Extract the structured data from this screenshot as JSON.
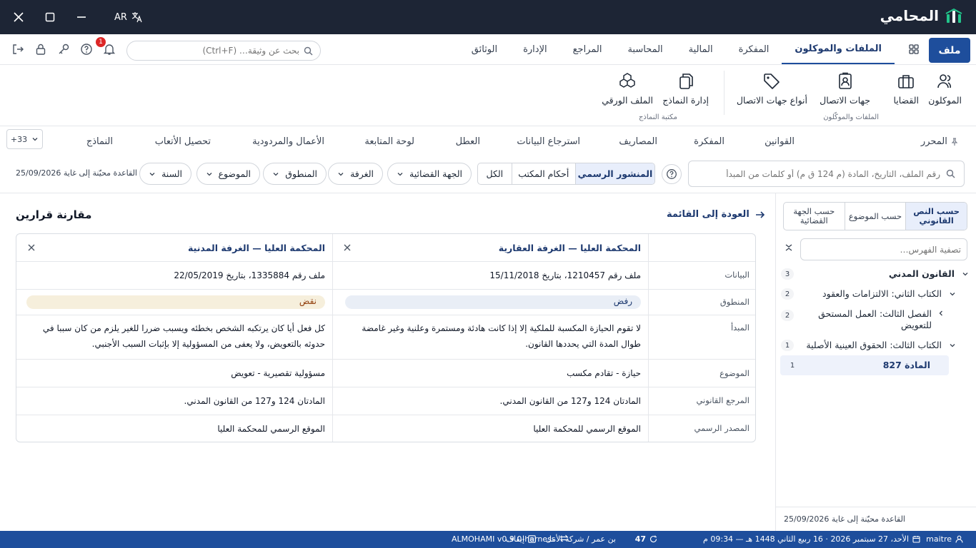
{
  "app": {
    "name": "المحامي",
    "lang": "AR"
  },
  "menu": {
    "file": "ملف",
    "tabs": [
      "الملفات والموكلون",
      "المفكرة",
      "المالية",
      "المحاسبة",
      "المراجع",
      "الإدارة",
      "الوثائق"
    ],
    "search_placeholder": "بحث عن وثيقة… (Ctrl+F)",
    "notifications_count": "1"
  },
  "ribbon": {
    "group1_items": [
      "الموكلون",
      "القضايا",
      "جهات الاتصال",
      "أنواع جهات الاتصال"
    ],
    "group1_label": "الملفات والموكّلون",
    "group2_items": [
      "إدارة النماذج",
      "الملف الورقي"
    ],
    "group2_label": "مكتبة النماذج"
  },
  "tabs2": {
    "items": [
      "المحرر",
      "القوانين",
      "المفكرة",
      "المصاريف",
      "استرجاع البيانات",
      "العطل",
      "لوحة المتابعة",
      "الأعمال والمردودية",
      "تحصيل الأتعاب",
      "النماذج"
    ],
    "more": "+33"
  },
  "filters": {
    "search_placeholder": "رقم الملف، التاريخ، المادة (م 124 ق م) أو كلمات من المبدأ",
    "segments": [
      "المنشور الرسمي",
      "أحكام المكتب",
      "الكل"
    ],
    "dropdowns": [
      "الجهة القضائية",
      "الغرفة",
      "المنطوق",
      "الموضوع",
      "السنة"
    ],
    "db_date": "القاعدة محيّنة إلى غاية 25/09/2026"
  },
  "sidebar": {
    "tabs": [
      "حسب النص القانوني",
      "حسب الموضوع",
      "حسب الجهة القضائية"
    ],
    "filter_placeholder": "تصفية الفهرس…",
    "tree": [
      {
        "label": "القانون المدني",
        "count": "3"
      },
      {
        "label": "الكتاب الثاني: الالتزامات والعقود",
        "count": "2"
      },
      {
        "label1": "الفصل الثالث: العمل المستحق",
        "label2": "للتعويض",
        "count": "2"
      },
      {
        "label": "الكتاب الثالث: الحقوق العينية الأصلية",
        "count": "1"
      },
      {
        "label": "المادة 827",
        "count": "1"
      }
    ],
    "footer": "القاعدة محيّنة إلى غاية 25/09/2026"
  },
  "compare": {
    "back": "العودة إلى القائمة",
    "title": "مقارنة قرارين",
    "col1_title": "المحكمة العليا — الغرفة العقارية",
    "col2_title": "المحكمة العليا — الغرفة المدنية",
    "rows": {
      "data_label": "البيانات",
      "data_1": "ملف رقم 1210457، بتاريخ 15/11/2018",
      "data_2": "ملف رقم 1335884، بتاريخ 22/05/2019",
      "ruling_label": "المنطوق",
      "ruling_1": "رفض",
      "ruling_2": "نقض",
      "principle_label": "المبدأ",
      "principle_1": "لا تقوم الحيازة المكسبة للملكية إلا إذا كانت هادئة ومستمرة وعلنية وغير غامضة طوال المدة التي يحددها القانون.",
      "principle_2": "كل فعل أيا كان يرتكبه الشخص بخطئه ويسبب ضررا للغير يلزم من كان سببا في حدوثه بالتعويض، ولا يعفى من المسؤولية إلا بإثبات السبب الأجنبي.",
      "subject_label": "الموضوع",
      "subject_1": "حيازة - تقادم مكسب",
      "subject_2": "مسؤولية تقصيرية - تعويض",
      "ref_label": "المرجع القانوني",
      "ref_1": "المادتان 124 و127 من القانون المدني.",
      "ref_2": "المادتان 124 و127 من القانون المدني.",
      "source_label": "المصدر الرسمي",
      "source_1": "الموقع الرسمي للمحكمة العليا",
      "source_2": "الموقع الرسمي للمحكمة العليا"
    }
  },
  "status": {
    "user": "maitre",
    "date": "الأحد، 27 سبتمبر 2026 · 16 ربيع الثاني 1448 هـ — 09:34 م",
    "tasks": "47",
    "firm": "بن عمر / شركة الأمل",
    "pause": "إيقاف",
    "version": "ALMOHAMI v0.9.0-harness"
  },
  "colors": {
    "titlebar": "#1d2535",
    "accent": "#1e4e9c",
    "ruling_reject": "#e9eef6",
    "ruling_cassation": "#f6efdc"
  }
}
